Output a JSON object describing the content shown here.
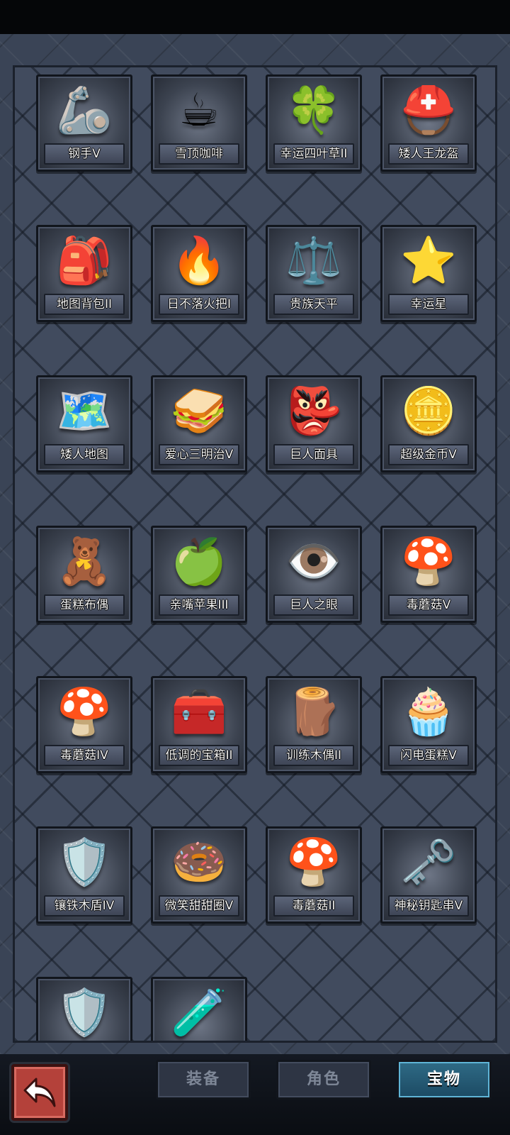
{
  "items": [
    {
      "name": "钢手V",
      "icon": "🦾"
    },
    {
      "name": "雪顶咖啡",
      "icon": "☕"
    },
    {
      "name": "幸运四叶草II",
      "icon": "🍀"
    },
    {
      "name": "矮人王龙盔",
      "icon": "⛑️"
    },
    {
      "name": "地图背包II",
      "icon": "🎒"
    },
    {
      "name": "日不落火把I",
      "icon": "🔥"
    },
    {
      "name": "贵族天平",
      "icon": "⚖️"
    },
    {
      "name": "幸运星",
      "icon": "⭐"
    },
    {
      "name": "矮人地图",
      "icon": "🗺️"
    },
    {
      "name": "爱心三明治V",
      "icon": "🥪"
    },
    {
      "name": "巨人面具",
      "icon": "👺"
    },
    {
      "name": "超级金币V",
      "icon": "🪙"
    },
    {
      "name": "蛋糕布偶",
      "icon": "🧸"
    },
    {
      "name": "亲嘴苹果III",
      "icon": "🍏"
    },
    {
      "name": "巨人之眼",
      "icon": "👁️"
    },
    {
      "name": "毒蘑菇V",
      "icon": "🍄"
    },
    {
      "name": "毒蘑菇IV",
      "icon": "🍄"
    },
    {
      "name": "低调的宝箱II",
      "icon": "🧰"
    },
    {
      "name": "训练木偶II",
      "icon": "🪵"
    },
    {
      "name": "闪电蛋糕V",
      "icon": "🧁"
    },
    {
      "name": "镶铁木盾IV",
      "icon": "🛡️"
    },
    {
      "name": "微笑甜甜圈V",
      "icon": "🍩"
    },
    {
      "name": "毒蘑菇II",
      "icon": "🍄"
    },
    {
      "name": "神秘钥匙串V",
      "icon": "🗝️"
    },
    {
      "name": "",
      "icon": "🛡️"
    },
    {
      "name": "",
      "icon": "🧪"
    }
  ],
  "tabs": [
    {
      "label": "装备",
      "active": false
    },
    {
      "label": "角色",
      "active": false
    },
    {
      "label": "宝物",
      "active": true
    }
  ],
  "back_icon": "back-arrow-icon"
}
